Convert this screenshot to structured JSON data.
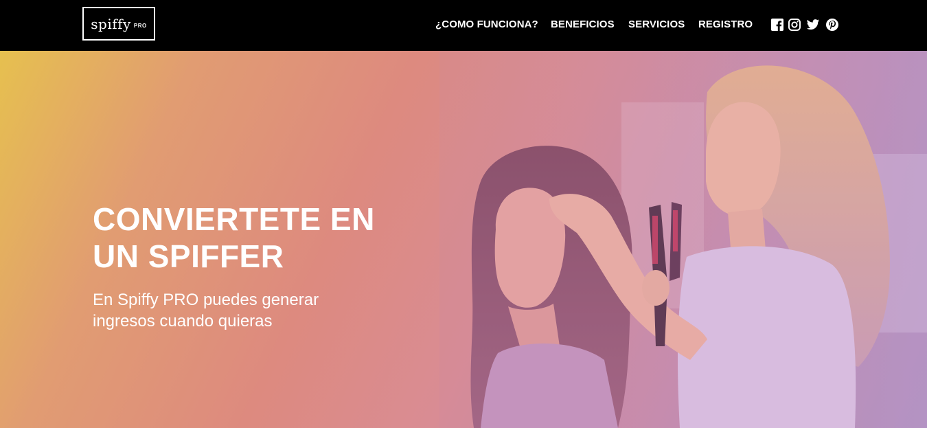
{
  "header": {
    "logo": {
      "word": "spiffy",
      "suffix": "PRO"
    },
    "nav": [
      {
        "label": "¿COMO FUNCIONA?"
      },
      {
        "label": "BENEFICIOS"
      },
      {
        "label": "SERVICIOS"
      },
      {
        "label": "REGISTRO"
      }
    ],
    "social": [
      "facebook-icon",
      "instagram-icon",
      "twitter-icon",
      "pinterest-icon"
    ]
  },
  "hero": {
    "title": "CONVIERTETE EN UN SPIFFER",
    "subtitle": "En Spiffy PRO puedes generar ingresos cuando quieras"
  },
  "colors": {
    "header_bg": "#000000",
    "gradient_start": "#e6c04f",
    "gradient_mid": "#dd8a7f",
    "gradient_end": "#a98fc4",
    "text": "#ffffff"
  }
}
